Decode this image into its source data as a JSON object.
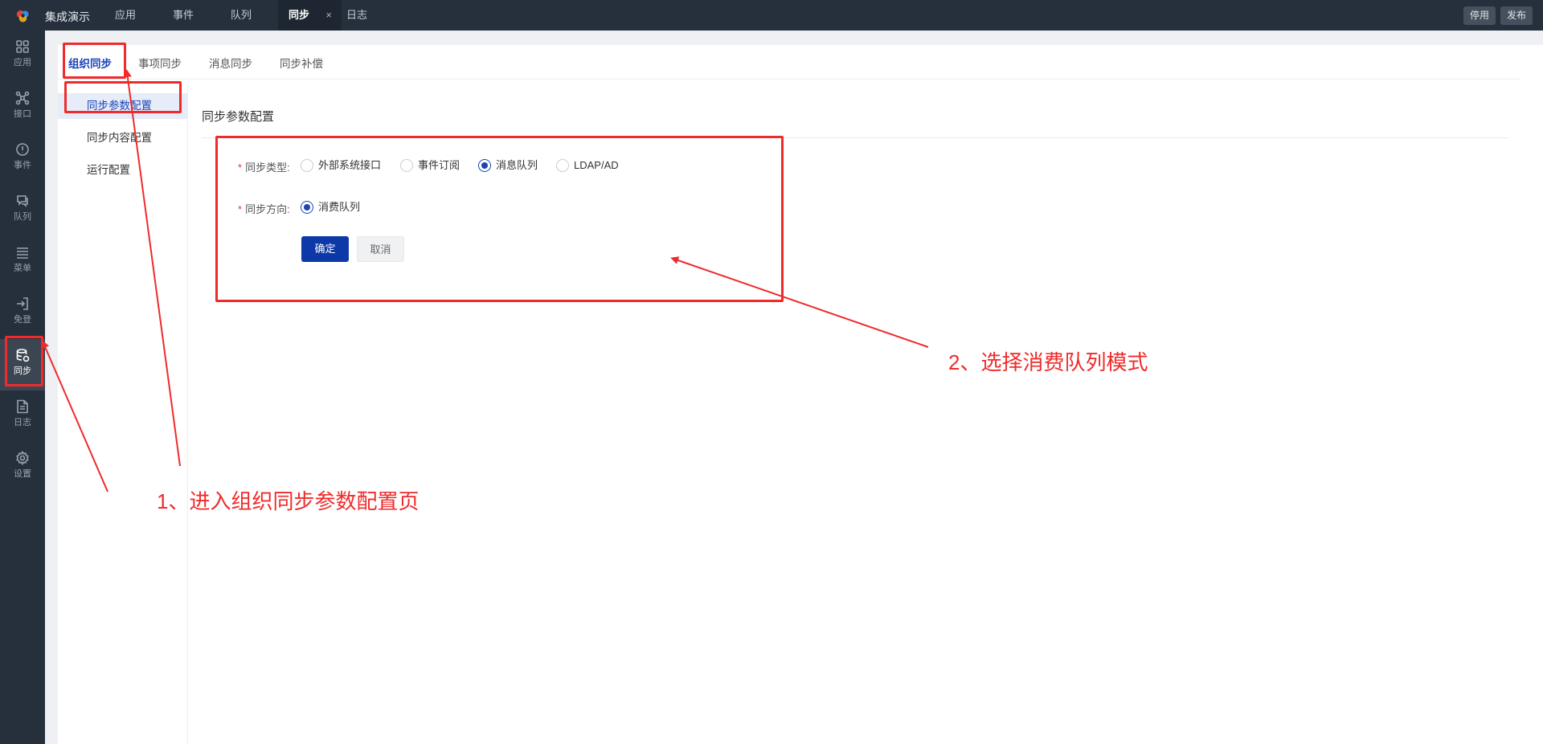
{
  "topbar": {
    "app_title": "集成演示",
    "tabs": [
      {
        "label": "应用"
      },
      {
        "label": "事件"
      },
      {
        "label": "队列"
      },
      {
        "label": "同步",
        "active": true
      },
      {
        "label": "日志"
      }
    ],
    "close_symbol": "×",
    "buttons": {
      "disable": "停用",
      "publish": "发布"
    }
  },
  "sidenav": {
    "items": [
      {
        "label": "应用",
        "icon": "grid-icon"
      },
      {
        "label": "接口",
        "icon": "network-icon"
      },
      {
        "label": "事件",
        "icon": "alert-circle-icon"
      },
      {
        "label": "队列",
        "icon": "chat-stack-icon"
      },
      {
        "label": "菜单",
        "icon": "menu-lines-icon"
      },
      {
        "label": "免登",
        "icon": "login-icon"
      },
      {
        "label": "同步",
        "icon": "database-sync-icon",
        "active": true
      },
      {
        "label": "日志",
        "icon": "document-icon"
      },
      {
        "label": "设置",
        "icon": "gear-icon"
      }
    ]
  },
  "subtabs": [
    {
      "label": "组织同步",
      "active": true
    },
    {
      "label": "事项同步"
    },
    {
      "label": "消息同步"
    },
    {
      "label": "同步补偿"
    }
  ],
  "leftmenu": [
    {
      "label": "同步参数配置",
      "active": true
    },
    {
      "label": "同步内容配置"
    },
    {
      "label": "运行配置"
    }
  ],
  "form": {
    "section_title": "同步参数配置",
    "required_mark": "*",
    "sync_type": {
      "label": "同步类型:",
      "options": [
        "外部系统接口",
        "事件订阅",
        "消息队列",
        "LDAP/AD"
      ],
      "selected": "消息队列"
    },
    "sync_direction": {
      "label": "同步方向:",
      "options": [
        "消费队列"
      ],
      "selected": "消费队列"
    },
    "confirm_label": "确定",
    "cancel_label": "取消"
  },
  "annotations": {
    "step1": "1、进入组织同步参数配置页",
    "step2": "2、选择消费队列模式",
    "color": "#ef2b2b"
  },
  "colors": {
    "topbar_bg": "#26303d",
    "primary": "#0d38a8",
    "active_text": "#1a44b8"
  }
}
